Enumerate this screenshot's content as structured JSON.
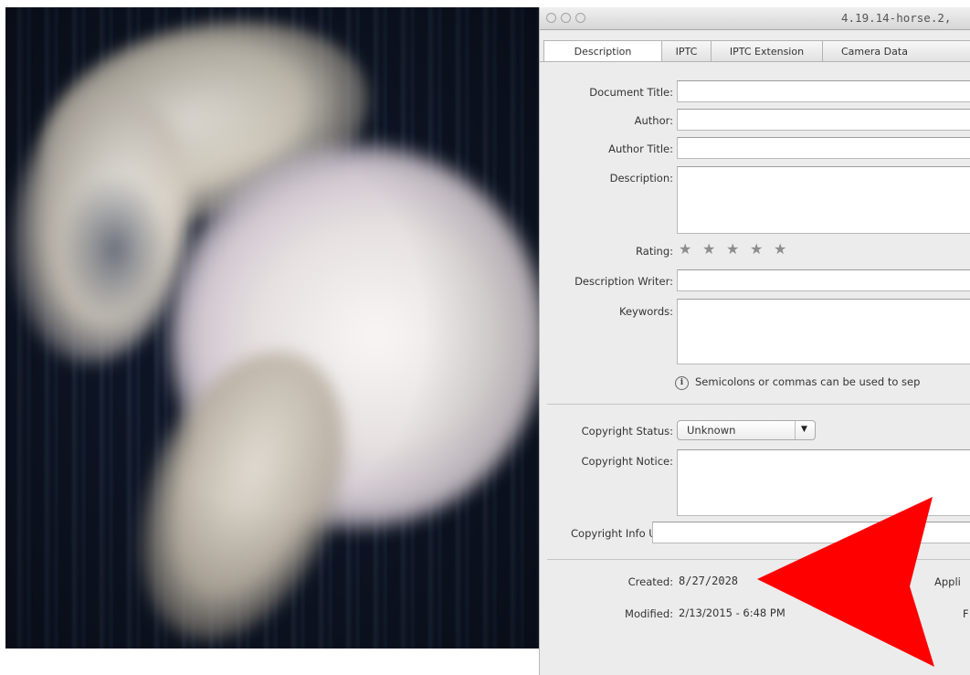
{
  "window": {
    "title": "4.19.14-horse.2,"
  },
  "tabs": [
    "Description",
    "IPTC",
    "IPTC Extension",
    "Camera Data"
  ],
  "fields": {
    "document_title": {
      "label": "Document Title:",
      "value": ""
    },
    "author": {
      "label": "Author:",
      "value": ""
    },
    "author_title": {
      "label": "Author Title:",
      "value": ""
    },
    "description": {
      "label": "Description:",
      "value": ""
    },
    "rating": {
      "label": "Rating:",
      "stars": 5,
      "value": 0
    },
    "description_writer": {
      "label": "Description Writer:",
      "value": ""
    },
    "keywords": {
      "label": "Keywords:",
      "value": ""
    }
  },
  "keywords_hint": "Semicolons or commas can be used to sep",
  "copyright": {
    "status_label": "Copyright Status:",
    "status_value": "Unknown",
    "notice_label": "Copyright Notice:",
    "url_label": "Copyright Info URL:"
  },
  "dates": {
    "created_label": "Created:",
    "created_value": "8/27/2028",
    "modified_label": "Modified:",
    "modified_value": "2/13/2015 - 6:48 PM"
  },
  "right_labels": {
    "application_partial": "Appli",
    "format_partial": "F"
  },
  "colors": {
    "annotation_arrow": "#ff0000",
    "dialog_bg": "#ececec",
    "photo_bg": "#0d1424"
  },
  "icons": {
    "info": "info-icon",
    "star": "star-icon",
    "dropdown": "chevron-down-icon"
  }
}
